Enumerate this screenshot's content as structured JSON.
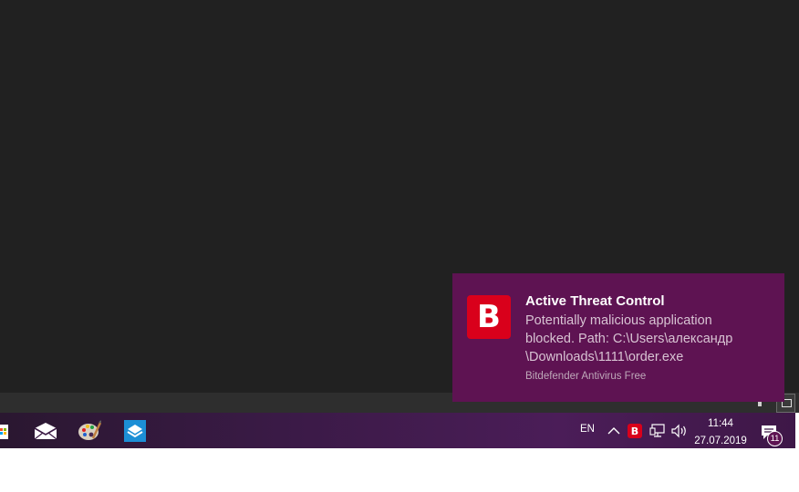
{
  "toast": {
    "title": "Active Threat Control",
    "body_lines": [
      "Potentially malicious application",
      "blocked. Path: C:\\Users\\александр",
      "\\Downloads\\1111\\order.exe"
    ],
    "attribution": "Bitdefender Antivirus Free",
    "logo_letter": "B",
    "logo_icon": "bitdefender-logo-icon",
    "background_color": "#5e1352",
    "logo_color": "#d9001b"
  },
  "taskbar": {
    "pinned": [
      {
        "name": "store-icon"
      },
      {
        "name": "mail-icon"
      },
      {
        "name": "paint-icon"
      },
      {
        "name": "sandbox-icon"
      }
    ]
  },
  "tray": {
    "language": "EN",
    "bitdefender_letter": "B",
    "time": "11:44",
    "date": "27.07.2019",
    "notification_count": "11",
    "icons": [
      "chevron-up-icon",
      "bitdefender-tray-icon",
      "network-icon",
      "volume-icon",
      "action-center-icon"
    ]
  }
}
